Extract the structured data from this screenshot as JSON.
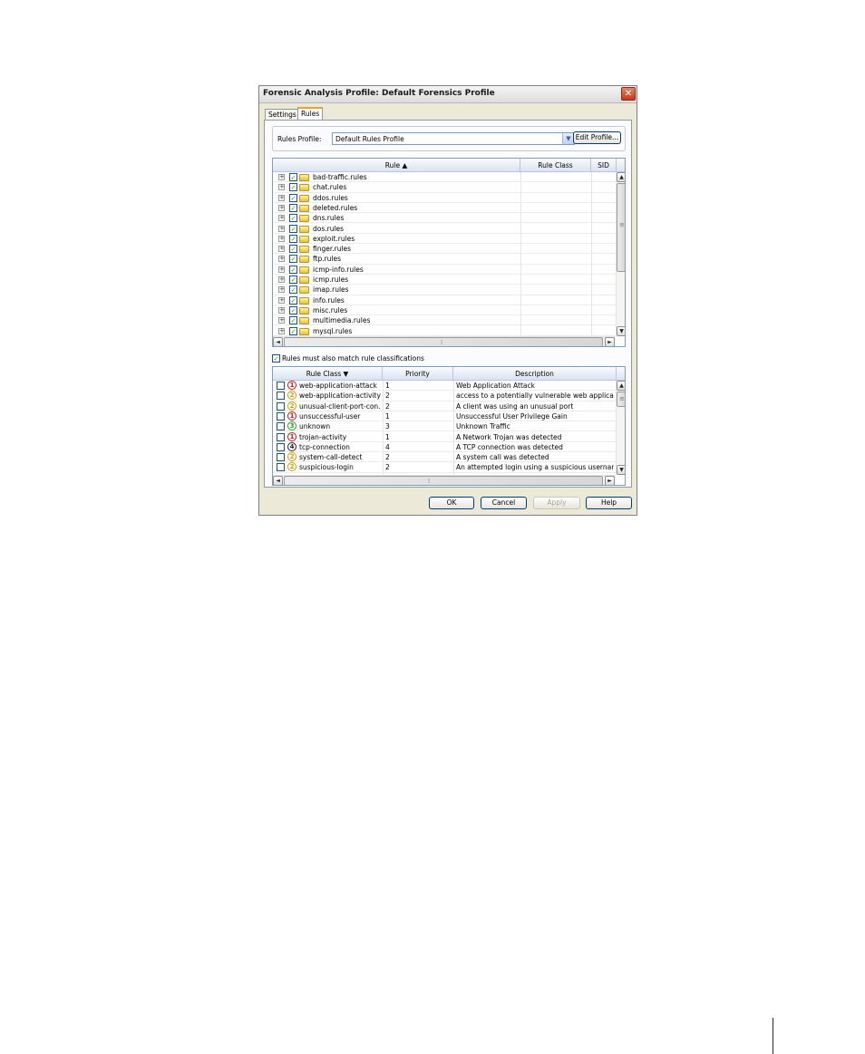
{
  "window": {
    "title": "Forensic Analysis Profile: Default Forensics Profile"
  },
  "tabs": [
    {
      "label": "Settings"
    },
    {
      "label": "Rules"
    }
  ],
  "profile": {
    "label": "Rules Profile:",
    "value": "Default Rules Profile",
    "edit_button": "Edit Profile..."
  },
  "rules_grid": {
    "columns": [
      "Rule ▲",
      "Rule Class",
      "SID"
    ],
    "rows": [
      "bad-traffic.rules",
      "chat.rules",
      "ddos.rules",
      "deleted.rules",
      "dns.rules",
      "dos.rules",
      "exploit.rules",
      "finger.rules",
      "ftp.rules",
      "icmp-info.rules",
      "icmp.rules",
      "imap.rules",
      "info.rules",
      "misc.rules",
      "multimedia.rules",
      "mysql.rules"
    ]
  },
  "match_classifications": {
    "label": "Rules must also match rule classifications",
    "checked": true
  },
  "class_grid": {
    "columns": [
      "Rule Class ▼",
      "Priority",
      "Description"
    ],
    "rows": [
      {
        "name": "web-application-attack",
        "priority": "1",
        "description": "Web Application Attack"
      },
      {
        "name": "web-application-activity",
        "priority": "2",
        "description": "access to a potentially vulnerable web application"
      },
      {
        "name": "unusual-client-port-con...",
        "priority": "2",
        "description": "A client was using an unusual port"
      },
      {
        "name": "unsuccessful-user",
        "priority": "1",
        "description": "Unsuccessful User Privilege Gain"
      },
      {
        "name": "unknown",
        "priority": "3",
        "description": "Unknown Traffic"
      },
      {
        "name": "trojan-activity",
        "priority": "1",
        "description": "A Network Trojan was detected"
      },
      {
        "name": "tcp-connection",
        "priority": "4",
        "description": "A TCP connection was detected"
      },
      {
        "name": "system-call-detect",
        "priority": "2",
        "description": "A system call was detected"
      },
      {
        "name": "suspicious-login",
        "priority": "2",
        "description": "An attempted login using a suspicious username was"
      }
    ]
  },
  "buttons": {
    "ok": "OK",
    "cancel": "Cancel",
    "apply": "Apply",
    "help": "Help"
  },
  "glyphs": {
    "close": "✕",
    "checkmark": "✓",
    "expand": "+",
    "dropdown": "▼",
    "up": "▲",
    "down": "▼",
    "left": "◄",
    "right": "►",
    "grip": "≡",
    "dots": "⁞"
  },
  "colors": {
    "priority_1": "#cc1111",
    "priority_2": "#c8a000",
    "priority_3": "#21a121",
    "priority_4": "#222222",
    "title_accent": "#f0a030"
  }
}
